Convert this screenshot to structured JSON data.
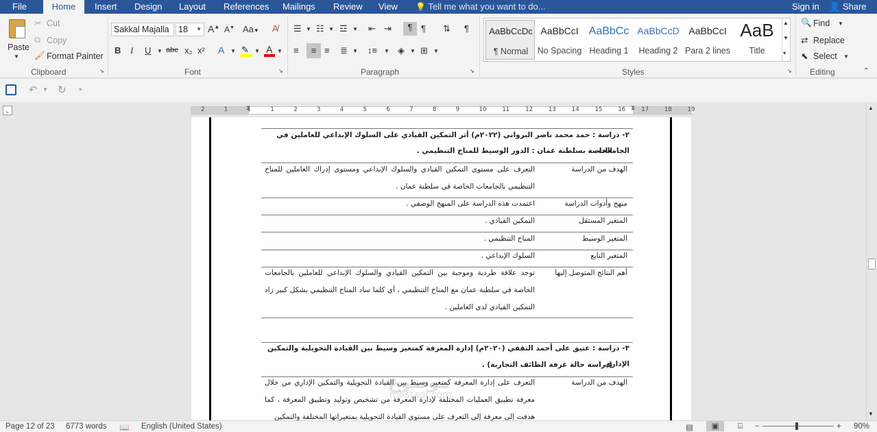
{
  "tabs": [
    "File",
    "Home",
    "Insert",
    "Design",
    "Layout",
    "References",
    "Mailings",
    "Review",
    "View"
  ],
  "tell_me": "Tell me what you want to do...",
  "sign_in": "Sign in",
  "share": "Share",
  "clipboard": {
    "paste": "Paste",
    "cut": "Cut",
    "copy": "Copy",
    "format_painter": "Format Painter",
    "label": "Clipboard"
  },
  "font": {
    "name": "Sakkal Majalla",
    "size": "18",
    "label": "Font",
    "bold": "B",
    "italic": "I",
    "underline": "U",
    "strike": "abc",
    "sub": "x₂",
    "sup": "x²",
    "case": "Aa",
    "grow": "A",
    "shrink": "A"
  },
  "paragraph": {
    "label": "Paragraph"
  },
  "styles": {
    "label": "Styles",
    "items": [
      {
        "preview": "AaBbCcDc",
        "name": "¶ Normal"
      },
      {
        "preview": "AaBbCcI",
        "name": "No Spacing"
      },
      {
        "preview": "AaBbCc",
        "name": "Heading 1"
      },
      {
        "preview": "AaBbCcD",
        "name": "Heading 2"
      },
      {
        "preview": "AaBbCcI",
        "name": "Para 2 lines"
      },
      {
        "preview": "AaB",
        "name": "Title"
      }
    ]
  },
  "editing": {
    "find": "Find",
    "replace": "Replace",
    "select": "Select",
    "label": "Editing"
  },
  "ruler_numbers": [
    "2",
    "1",
    "1",
    "1",
    "2",
    "3",
    "4",
    "5",
    "6",
    "7",
    "8",
    "9",
    "10",
    "11",
    "12",
    "13",
    "14",
    "15",
    "16",
    "17",
    "18",
    "19"
  ],
  "document": {
    "study2": {
      "title_line1": "٢- دراسة : حمد محمد ناصر البرواني (٢٠٢٢م) أثر التمكين القيادي على السلوك الإبداعي للعاملين في الجامعات",
      "title_line2": "الخاصة بسلطنة عمان : الدور الوسيط للمناخ التنظيمي .",
      "rows": [
        {
          "label": "الهدف من الدراسة",
          "value": "التعرف على مستوى التمكين القيادي والسلوك الإبداعي ومستوى إدراك العاملين للمناخ التنظيمي بالجامعات الخاصة في سلطنة عمان ."
        },
        {
          "label": "منهج وأدوات الدراسة",
          "value": "اعتمدت هذه الدراسة على المنهج الوصفي ."
        },
        {
          "label": "المتغير المستقل",
          "value": "التمكين القيادي ."
        },
        {
          "label": "المتغير الوسيط",
          "value": "المناخ التنظيمي ."
        },
        {
          "label": "المتغير التابع",
          "value": "السلوك الإبداعي ."
        },
        {
          "label": "أهم النتائج المتوصل إليها",
          "value": "توجد علاقة طردية وموجبة بين التمكين القيادي والسلوك الإبداعي للعاملين بالجامعات الخاصة في سلطنة عمان مع المناخ التنظيمي ، أي كلما ساد المناخ التنظيمي بشكل كبير زاد التمكين القيادي لدى العاملين ."
        }
      ]
    },
    "study3": {
      "title_line1": "٣- دراسة : عتيق على أحمد الثقفي (٢٠٢٠م) إدارة المعرفة كمتغير وسيط بين القيادة التحويلية والتمكين الإداري",
      "title_line2": "(دراسة حالة غرفة الطائف التجارية) .",
      "rows": [
        {
          "label": "الهدف من الدراسة",
          "value": "التعرف على إدارة المعرفة كمتغير وسيط بين القيادة التحويلية والتمكين الإداري من خلال معرفة تطبيق العمليات المختلفة لإدارة المعرفة من تشخيص وتوليد وتطبيق المعرفة ، كما هدفت إلى معرفة إلى التعرف على مستوى القيادة التحويلية بمتغيراتها المختلفة والتمكين"
        }
      ]
    },
    "watermark": "موضوع",
    "watermark_sub": "mostaql.com"
  },
  "status": {
    "page": "Page 12 of 23",
    "words": "6773 words",
    "language": "English (United States)",
    "zoom": "90%"
  }
}
